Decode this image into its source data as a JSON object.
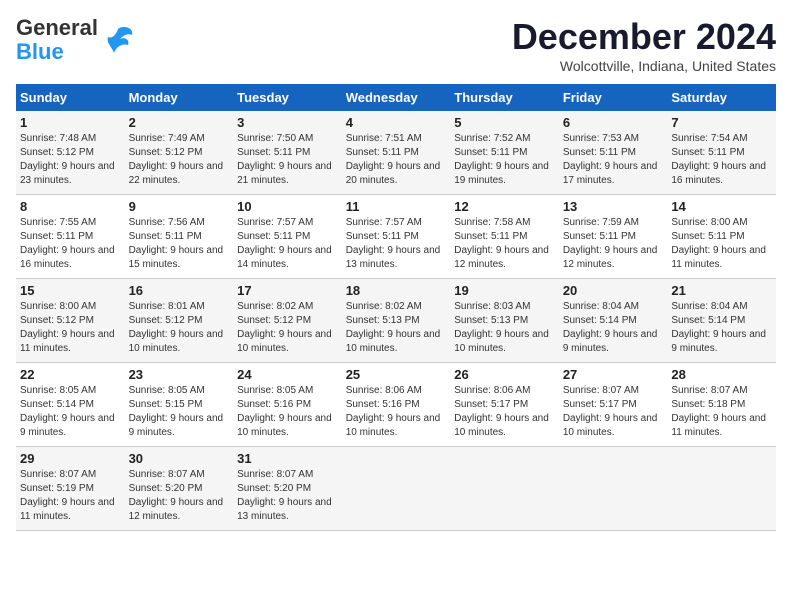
{
  "header": {
    "logo_line1": "General",
    "logo_line2": "Blue",
    "month_title": "December 2024",
    "location": "Wolcottville, Indiana, United States"
  },
  "weekdays": [
    "Sunday",
    "Monday",
    "Tuesday",
    "Wednesday",
    "Thursday",
    "Friday",
    "Saturday"
  ],
  "weeks": [
    [
      {
        "day": "1",
        "sunrise": "7:48 AM",
        "sunset": "5:12 PM",
        "daylight": "9 hours and 23 minutes."
      },
      {
        "day": "2",
        "sunrise": "7:49 AM",
        "sunset": "5:12 PM",
        "daylight": "9 hours and 22 minutes."
      },
      {
        "day": "3",
        "sunrise": "7:50 AM",
        "sunset": "5:11 PM",
        "daylight": "9 hours and 21 minutes."
      },
      {
        "day": "4",
        "sunrise": "7:51 AM",
        "sunset": "5:11 PM",
        "daylight": "9 hours and 20 minutes."
      },
      {
        "day": "5",
        "sunrise": "7:52 AM",
        "sunset": "5:11 PM",
        "daylight": "9 hours and 19 minutes."
      },
      {
        "day": "6",
        "sunrise": "7:53 AM",
        "sunset": "5:11 PM",
        "daylight": "9 hours and 17 minutes."
      },
      {
        "day": "7",
        "sunrise": "7:54 AM",
        "sunset": "5:11 PM",
        "daylight": "9 hours and 16 minutes."
      }
    ],
    [
      {
        "day": "8",
        "sunrise": "7:55 AM",
        "sunset": "5:11 PM",
        "daylight": "9 hours and 16 minutes."
      },
      {
        "day": "9",
        "sunrise": "7:56 AM",
        "sunset": "5:11 PM",
        "daylight": "9 hours and 15 minutes."
      },
      {
        "day": "10",
        "sunrise": "7:57 AM",
        "sunset": "5:11 PM",
        "daylight": "9 hours and 14 minutes."
      },
      {
        "day": "11",
        "sunrise": "7:57 AM",
        "sunset": "5:11 PM",
        "daylight": "9 hours and 13 minutes."
      },
      {
        "day": "12",
        "sunrise": "7:58 AM",
        "sunset": "5:11 PM",
        "daylight": "9 hours and 12 minutes."
      },
      {
        "day": "13",
        "sunrise": "7:59 AM",
        "sunset": "5:11 PM",
        "daylight": "9 hours and 12 minutes."
      },
      {
        "day": "14",
        "sunrise": "8:00 AM",
        "sunset": "5:11 PM",
        "daylight": "9 hours and 11 minutes."
      }
    ],
    [
      {
        "day": "15",
        "sunrise": "8:00 AM",
        "sunset": "5:12 PM",
        "daylight": "9 hours and 11 minutes."
      },
      {
        "day": "16",
        "sunrise": "8:01 AM",
        "sunset": "5:12 PM",
        "daylight": "9 hours and 10 minutes."
      },
      {
        "day": "17",
        "sunrise": "8:02 AM",
        "sunset": "5:12 PM",
        "daylight": "9 hours and 10 minutes."
      },
      {
        "day": "18",
        "sunrise": "8:02 AM",
        "sunset": "5:13 PM",
        "daylight": "9 hours and 10 minutes."
      },
      {
        "day": "19",
        "sunrise": "8:03 AM",
        "sunset": "5:13 PM",
        "daylight": "9 hours and 10 minutes."
      },
      {
        "day": "20",
        "sunrise": "8:04 AM",
        "sunset": "5:14 PM",
        "daylight": "9 hours and 9 minutes."
      },
      {
        "day": "21",
        "sunrise": "8:04 AM",
        "sunset": "5:14 PM",
        "daylight": "9 hours and 9 minutes."
      }
    ],
    [
      {
        "day": "22",
        "sunrise": "8:05 AM",
        "sunset": "5:14 PM",
        "daylight": "9 hours and 9 minutes."
      },
      {
        "day": "23",
        "sunrise": "8:05 AM",
        "sunset": "5:15 PM",
        "daylight": "9 hours and 9 minutes."
      },
      {
        "day": "24",
        "sunrise": "8:05 AM",
        "sunset": "5:16 PM",
        "daylight": "9 hours and 10 minutes."
      },
      {
        "day": "25",
        "sunrise": "8:06 AM",
        "sunset": "5:16 PM",
        "daylight": "9 hours and 10 minutes."
      },
      {
        "day": "26",
        "sunrise": "8:06 AM",
        "sunset": "5:17 PM",
        "daylight": "9 hours and 10 minutes."
      },
      {
        "day": "27",
        "sunrise": "8:07 AM",
        "sunset": "5:17 PM",
        "daylight": "9 hours and 10 minutes."
      },
      {
        "day": "28",
        "sunrise": "8:07 AM",
        "sunset": "5:18 PM",
        "daylight": "9 hours and 11 minutes."
      }
    ],
    [
      {
        "day": "29",
        "sunrise": "8:07 AM",
        "sunset": "5:19 PM",
        "daylight": "9 hours and 11 minutes."
      },
      {
        "day": "30",
        "sunrise": "8:07 AM",
        "sunset": "5:20 PM",
        "daylight": "9 hours and 12 minutes."
      },
      {
        "day": "31",
        "sunrise": "8:07 AM",
        "sunset": "5:20 PM",
        "daylight": "9 hours and 13 minutes."
      },
      null,
      null,
      null,
      null
    ]
  ]
}
